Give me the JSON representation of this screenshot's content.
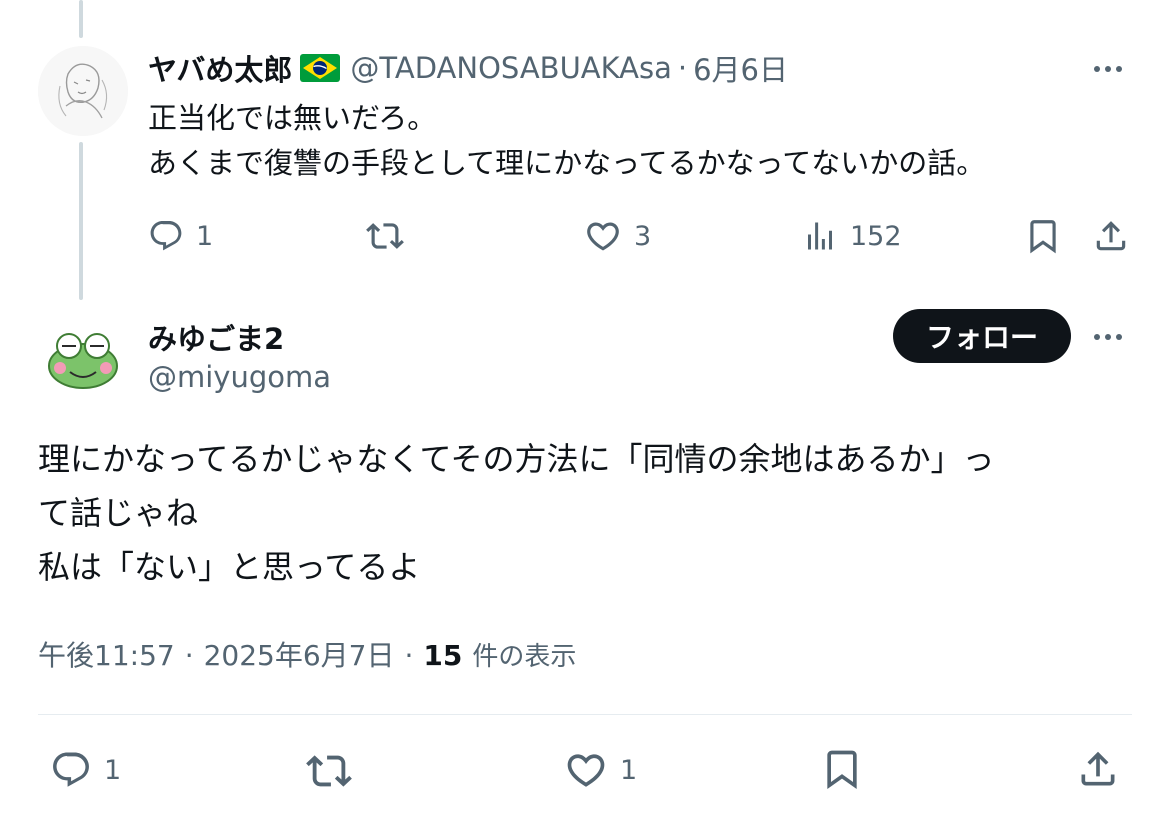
{
  "parent_tweet": {
    "display_name": "ヤバめ太郎",
    "flag_icon": "brazil-flag-icon",
    "handle": "@TADANOSABUAKAsa",
    "separator": "·",
    "date": "6月6日",
    "text_line_1": "正当化では無いだろ。",
    "text_line_2": "あくまで復讐の手段として理にかなってるかなってないかの話。",
    "reply_count": "1",
    "retweet_count": "",
    "like_count": "3",
    "view_count": "152"
  },
  "main_tweet": {
    "display_name": "みゆごま2",
    "handle": "@miyugoma",
    "follow_label": "フォロー",
    "text_line_1": "理にかなってるかじゃなくてその方法に「同情の余地はあるか」っ",
    "text_line_2": "て話じゃね",
    "text_line_3": "私は「ない」と思ってるよ",
    "time": "午後11:57",
    "separator": "·",
    "date": "2025年6月7日",
    "separator2": "·",
    "view_count": "15",
    "view_label": "件の表示",
    "reply_count": "1",
    "like_count": "1"
  },
  "colors": {
    "text": "#0f1419",
    "muted": "#536471",
    "thread_line": "#cfd9de",
    "button_bg": "#0f1419",
    "flag_green": "#009c3b",
    "flag_yellow": "#ffdf00",
    "flag_blue": "#002776"
  }
}
